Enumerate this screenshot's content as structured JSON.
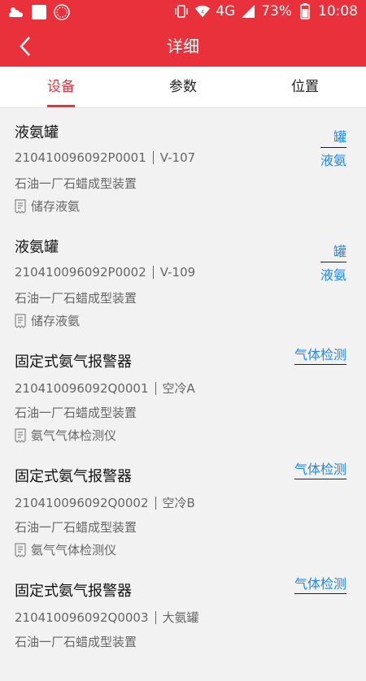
{
  "status_bar": {
    "battery": "73%",
    "network": "4G",
    "time": "10:08",
    "icons": [
      "weather-icon",
      "notification-icon",
      "app-icon",
      "vibrate-icon",
      "wifi-icon",
      "signal-icon",
      "battery-icon"
    ]
  },
  "header": {
    "title": "详细"
  },
  "tabs": [
    {
      "label": "设备",
      "active": true
    },
    {
      "label": "参数",
      "active": false
    },
    {
      "label": "位置",
      "active": false
    }
  ],
  "items": [
    {
      "name": "液氨罐",
      "code": "210410096092P0001",
      "tag_no": "V-107",
      "org": "石油一厂石蜡成型装置",
      "desc": "储存液氨",
      "tag_lines": [
        "罐",
        "液氨"
      ]
    },
    {
      "name": "液氨罐",
      "code": "210410096092P0002",
      "tag_no": "V-109",
      "org": "石油一厂石蜡成型装置",
      "desc": "储存液氨",
      "tag_lines": [
        "罐",
        "液氨"
      ]
    },
    {
      "name": "固定式氨气报警器",
      "code": "210410096092Q0001",
      "tag_no": "空冷A",
      "org": "石油一厂石蜡成型装置",
      "desc": "氨气气体检测仪",
      "tag_lines": [
        "气体检测"
      ]
    },
    {
      "name": "固定式氨气报警器",
      "code": "210410096092Q0002",
      "tag_no": "空冷B",
      "org": "石油一厂石蜡成型装置",
      "desc": "氨气气体检测仪",
      "tag_lines": [
        "气体检测"
      ]
    },
    {
      "name": "固定式氨气报警器",
      "code": "210410096092Q0003",
      "tag_no": "大氨罐",
      "org": "石油一厂石蜡成型装置",
      "desc": "",
      "tag_lines": [
        "气体检测"
      ]
    }
  ],
  "colors": {
    "primary": "#e8313a",
    "link": "#1e88e5"
  }
}
